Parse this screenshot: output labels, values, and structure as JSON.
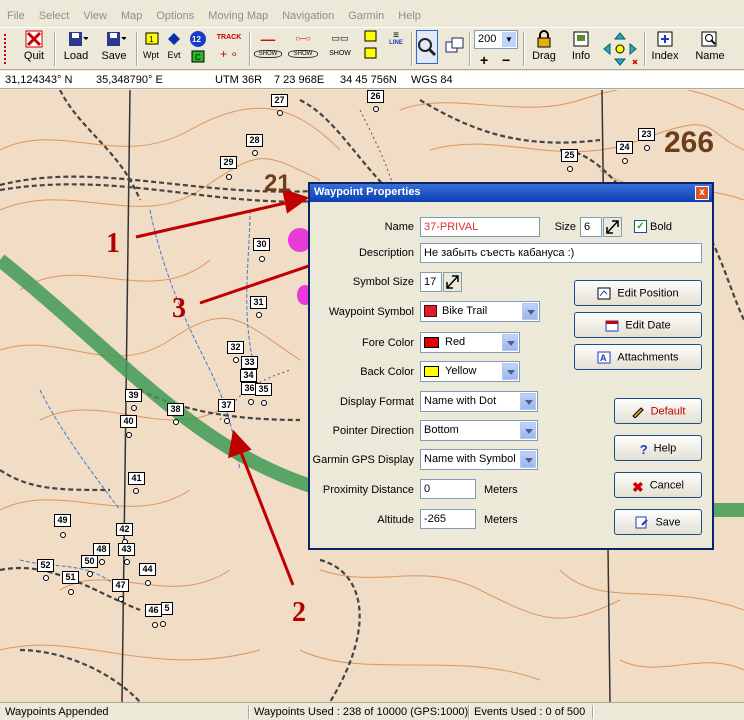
{
  "menu": [
    "File",
    "Select",
    "View",
    "Map",
    "Options",
    "Moving Map",
    "Navigation",
    "Garmin",
    "Help"
  ],
  "toolbar": {
    "quit": "Quit",
    "load": "Load",
    "save": "Save",
    "wpt": "Wpt",
    "evt": "Evt",
    "route_num": "12",
    "track": "TRACK",
    "show1": "SHOW",
    "show2": "SHOW",
    "show3": "SHOW",
    "line": "LINE",
    "zoom_value": "200",
    "drag": "Drag",
    "info": "Info",
    "index": "Index",
    "name": "Name"
  },
  "coords": {
    "lat": "31,124343° N",
    "lon": "35,348790° E",
    "utm": "UTM  36R",
    "easting": "7 23 968E",
    "northing": "34 45 756N",
    "datum": "WGS 84"
  },
  "waypoints": [
    {
      "label": "27"
    },
    {
      "label": "26"
    },
    {
      "label": "28"
    },
    {
      "label": "29"
    },
    {
      "label": "23"
    },
    {
      "label": "24"
    },
    {
      "label": "25"
    },
    {
      "label": "30"
    },
    {
      "label": "31"
    },
    {
      "label": "32"
    },
    {
      "label": "33"
    },
    {
      "label": "34"
    },
    {
      "label": "36"
    },
    {
      "label": "35"
    },
    {
      "label": "37"
    },
    {
      "label": "38"
    },
    {
      "label": "39"
    },
    {
      "label": "40"
    },
    {
      "label": "41"
    },
    {
      "label": "49"
    },
    {
      "label": "42"
    },
    {
      "label": "48"
    },
    {
      "label": "43"
    },
    {
      "label": "50"
    },
    {
      "label": "52"
    },
    {
      "label": "51"
    },
    {
      "label": "47"
    },
    {
      "label": "44"
    },
    {
      "label": "46"
    },
    {
      "label": "5"
    }
  ],
  "map_labels": {
    "elev_right": "266",
    "elev_mid": "21"
  },
  "annotations": {
    "a1": "1",
    "a2": "2",
    "a3": "3"
  },
  "dialog": {
    "title": "Waypoint Properties",
    "close": "x",
    "name_label": "Name",
    "name_value": "37-PRIVAL",
    "size_label": "Size",
    "size_value": "6",
    "bold_label": "Bold",
    "description_label": "Description",
    "description_value": "Не забыть съесть кабануса :)",
    "symbol_size_label": "Symbol Size",
    "symbol_size_value": "17",
    "waypoint_symbol_label": "Waypoint Symbol",
    "waypoint_symbol_value": "Bike Trail",
    "fore_color_label": "Fore Color",
    "fore_color_value": "Red",
    "back_color_label": "Back Color",
    "back_color_value": "Yellow",
    "display_format_label": "Display Format",
    "display_format_value": "Name with Dot",
    "pointer_direction_label": "Pointer Direction",
    "pointer_direction_value": "Bottom",
    "garmin_display_label": "Garmin GPS Display",
    "garmin_display_value": "Name with Symbol",
    "proximity_label": "Proximity Distance",
    "proximity_value": "0",
    "proximity_unit": "Meters",
    "altitude_label": "Altitude",
    "altitude_value": "-265",
    "altitude_unit": "Meters",
    "edit_position": "Edit Position",
    "edit_date": "Edit Date",
    "attachments": "Attachments",
    "default": "Default",
    "help": "Help",
    "cancel": "Cancel",
    "save": "Save"
  },
  "colors": {
    "fore": "#e00000",
    "back": "#ffff00",
    "name_text": "#e03030",
    "arrow": "#c00000"
  },
  "status": {
    "left": "Waypoints Appended",
    "used": "Waypoints Used : 238 of 10000  (GPS:1000)",
    "events": "Events Used : 0 of 500"
  }
}
